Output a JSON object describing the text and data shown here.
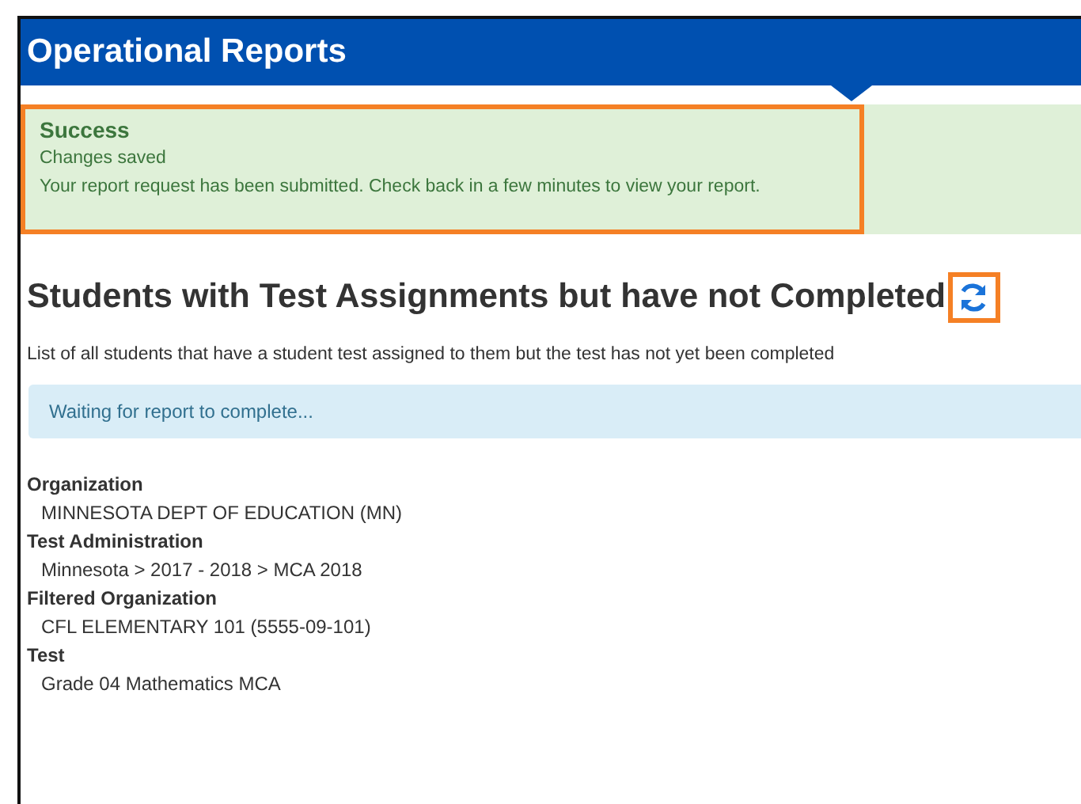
{
  "header": {
    "title": "Operational Reports"
  },
  "alert": {
    "title": "Success",
    "lines": [
      "Changes saved",
      "Your report request has been submitted. Check back in a few minutes to view your report."
    ],
    "highlighted": true
  },
  "report": {
    "title": "Students with Test Assignments but have not Completed",
    "refresh_highlighted": true,
    "description": "List of all students that have a student test assigned to them but the test has not yet been completed",
    "status": "Waiting for report to complete..."
  },
  "details": [
    {
      "label": "Organization",
      "value": "MINNESOTA DEPT OF EDUCATION (MN)"
    },
    {
      "label": "Test Administration",
      "value": "Minnesota > 2017 - 2018 > MCA 2018"
    },
    {
      "label": "Filtered Organization",
      "value": "CFL ELEMENTARY 101 (5555-09-101)"
    },
    {
      "label": "Test",
      "value": "Grade 04 Mathematics MCA"
    }
  ]
}
